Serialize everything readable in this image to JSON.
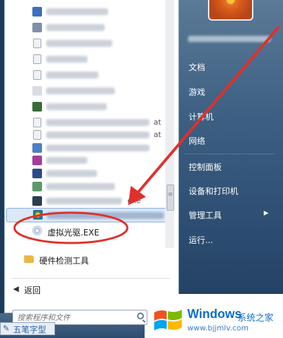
{
  "programs": {
    "virtual_drive_label": "虚拟光驱.EXE",
    "folder_label": "硬件检测工具",
    "suffix_bat": "at",
    "suffix_exe": "exe"
  },
  "nav": {
    "back_label": "返回"
  },
  "search": {
    "placeholder": "搜索程序和文件"
  },
  "right_menu": {
    "items": [
      "文档",
      "游戏",
      "计算机",
      "网络",
      "控制面板",
      "设备和打印机",
      "管理工具",
      "运行..."
    ],
    "has_submenu": [
      false,
      false,
      false,
      false,
      false,
      false,
      true,
      false
    ]
  },
  "watermark_left": {
    "label": "五笔字型"
  },
  "watermark_right": {
    "brand": "Windows",
    "site_name": "系统之家",
    "url": "www.bjjmlv.com"
  },
  "colors": {
    "annotation_red": "#e0302a",
    "highlight": "#dbe8f8",
    "brand_blue": "#0d6fc8"
  }
}
